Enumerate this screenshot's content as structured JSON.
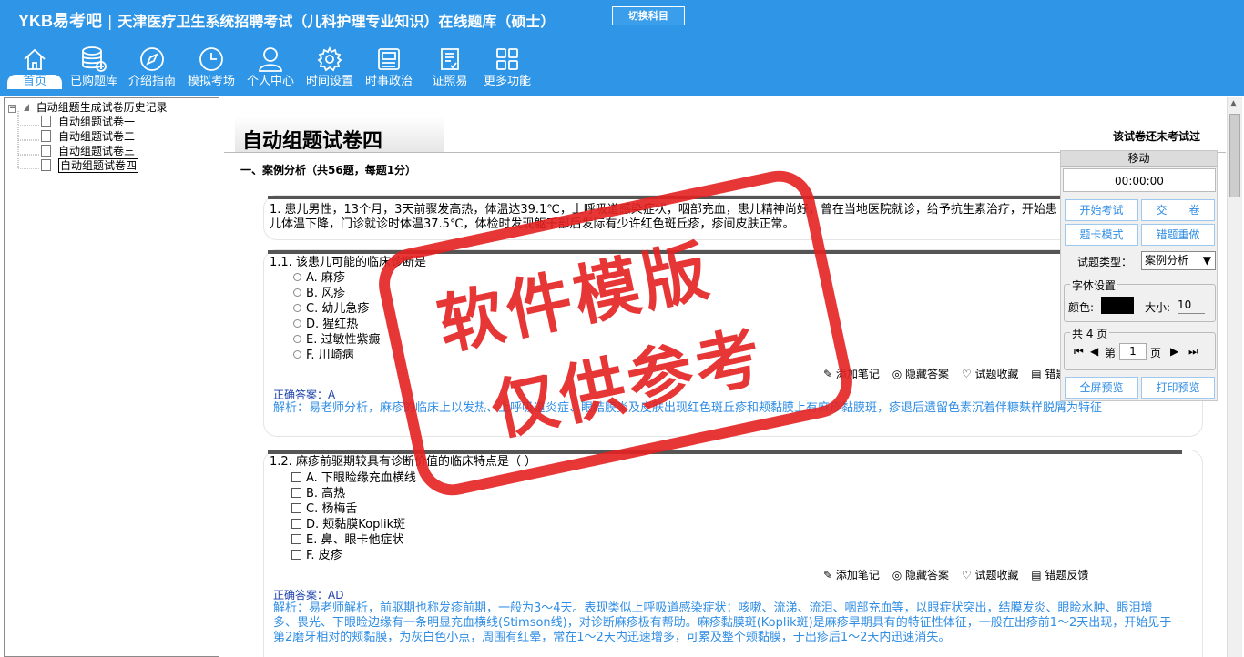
{
  "header": {
    "logo": "YKB易考吧",
    "exam_title": "天津医疗卫生系统招聘考试（儿科护理专业知识）在线题库（硕士）",
    "switch_label": "切换科目"
  },
  "nav": [
    {
      "label": "首页",
      "icon": "home-icon"
    },
    {
      "label": "已购题库",
      "icon": "database-icon"
    },
    {
      "label": "介绍指南",
      "icon": "compass-icon"
    },
    {
      "label": "模拟考场",
      "icon": "clock-icon"
    },
    {
      "label": "个人中心",
      "icon": "user-icon"
    },
    {
      "label": "时间设置",
      "icon": "gear-icon"
    },
    {
      "label": "时事政治",
      "icon": "news-icon"
    },
    {
      "label": "证照易",
      "icon": "certificate-icon"
    },
    {
      "label": "更多功能",
      "icon": "grid-icon"
    }
  ],
  "tree": {
    "root": "自动组题生成试卷历史记录",
    "items": [
      "自动组题试卷一",
      "自动组题试卷二",
      "自动组题试卷三",
      "自动组题试卷四"
    ],
    "selected": "自动组题试卷四"
  },
  "paper": {
    "title": "自动组题试卷四",
    "status": "该试卷还未考试过",
    "section": "一、案例分析（共56题，每题1分）"
  },
  "case1": {
    "stem": "1. 患儿男性，13个月，3天前骤发高热，体温达39.1℃，上呼吸道感染症状，咽部充血，患儿精神尚好，曾在当地医院就诊，给予抗生素治疗，开始患儿体温下降，门诊就诊时体温37.5℃，体检时发现躯干部后发际有少许红色斑丘疹，疹间皮肤正常。"
  },
  "q1": {
    "stem": "1.1. 该患儿可能的临床诊断是",
    "options": [
      "A. 麻疹",
      "B. 风疹",
      "C. 幼儿急疹",
      "D. 猩红热",
      "E. 过敏性紫癜",
      "F. 川崎病"
    ],
    "answer_label": "正确答案：",
    "answer": "A",
    "analysis": "解析：易老师分析，麻疹的临床上以发热、上呼吸道炎症、眼结膜炎及皮肤出现红色斑丘疹和颊黏膜上有麻疹黏膜斑，疹退后遗留色素沉着伴糠麸样脱屑为特征"
  },
  "q2": {
    "stem": "1.2. 麻疹前驱期较具有诊断价值的临床特点是（ ）",
    "options": [
      "A. 下眼睑缘充血横线",
      "B. 高热",
      "C. 杨梅舌",
      "D. 颊黏膜Koplik斑",
      "E. 鼻、眼卡他症状",
      "F. 皮疹"
    ],
    "answer_label": "正确答案：",
    "answer": "AD",
    "analysis": "解析：易老师解析，前驱期也称发疹前期，一般为3～4天。表现类似上呼吸道感染症状：咳嗽、流涕、流泪、咽部充血等，以眼症状突出，结膜发炎、眼睑水肿、眼泪增多、畏光、下眼睑边缘有一条明显充血横线(Stimson线)，对诊断麻疹极有帮助。麻疹黏膜斑(Koplik斑)是麻疹早期具有的特征性体征，一般在出疹前1～2天出现，开始见于第2磨牙相对的颊黏膜，为灰白色小点，周围有红晕，常在1～2天内迅速增多，可累及整个颊黏膜，于出疹后1～2天内迅速消失。"
  },
  "tools": {
    "note": "添加笔记",
    "hide": "隐藏答案",
    "fav": "试题收藏",
    "feedback": "错题反馈"
  },
  "panel": {
    "move": "移动",
    "timer": "00:00:00",
    "start": "开始考试",
    "submit": "交　　卷",
    "card_mode": "题卡模式",
    "wrong_redo": "错题重做",
    "type_label": "试题类型：",
    "type_value": "案例分析",
    "font_title": "字体设置",
    "color_label": "颜色:",
    "size_label": "大小:",
    "size_value": "10",
    "pages_title": "共 4 页",
    "page_prefix": "第",
    "page_value": "1",
    "page_suffix": "页",
    "fullscreen": "全屏预览",
    "print": "打印预览"
  },
  "watermark": {
    "line1": "软件模版",
    "line2": "仅供参考"
  }
}
